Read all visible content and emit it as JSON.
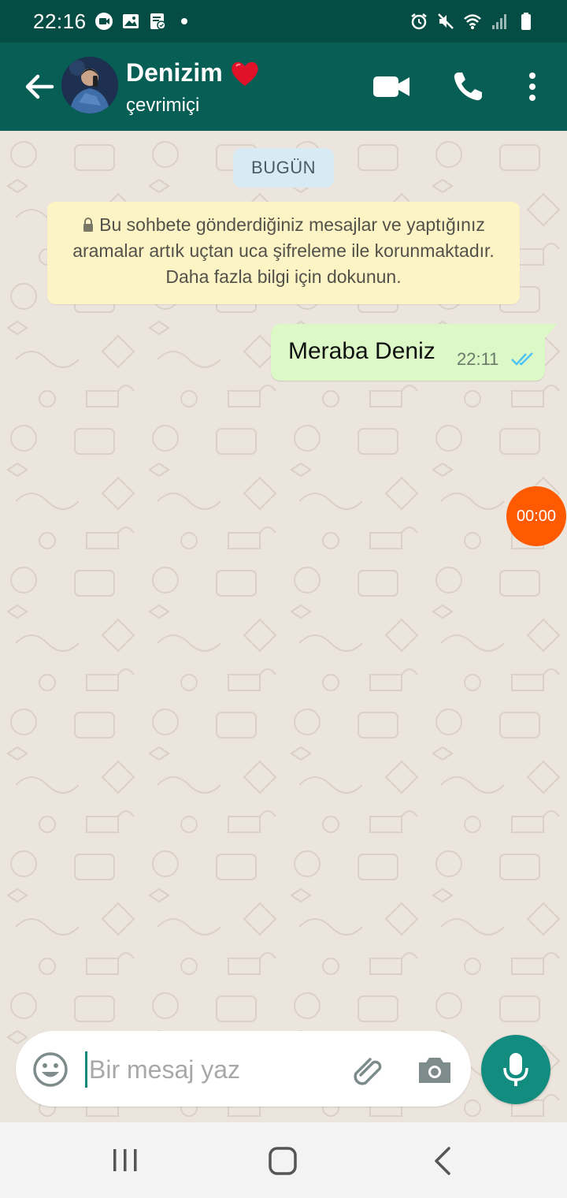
{
  "status_bar": {
    "time": "22:16"
  },
  "header": {
    "contact_name": "Denizim",
    "contact_status": "çevrimiçi"
  },
  "chat": {
    "date_label": "BUGÜN",
    "encryption_notice": "Bu sohbete gönderdiğiniz mesajlar ve yaptığınız aramalar artık uçtan uca şifreleme ile korunmaktadır. Daha fazla bilgi için dokunun.",
    "messages": [
      {
        "text": "Meraba Deniz",
        "time": "22:11",
        "status": "read"
      }
    ],
    "recording_timer": "00:00"
  },
  "composer": {
    "placeholder": "Bir mesaj yaz"
  },
  "colors": {
    "header": "#075e54",
    "status_bar": "#054d44",
    "outgoing_bubble": "#dcf8c6",
    "notice": "#fdf4c5",
    "date_pill": "#d8eaf4",
    "mic_button": "#128c7e",
    "recording": "#ff5a00",
    "read_ticks": "#4fc3f7"
  }
}
